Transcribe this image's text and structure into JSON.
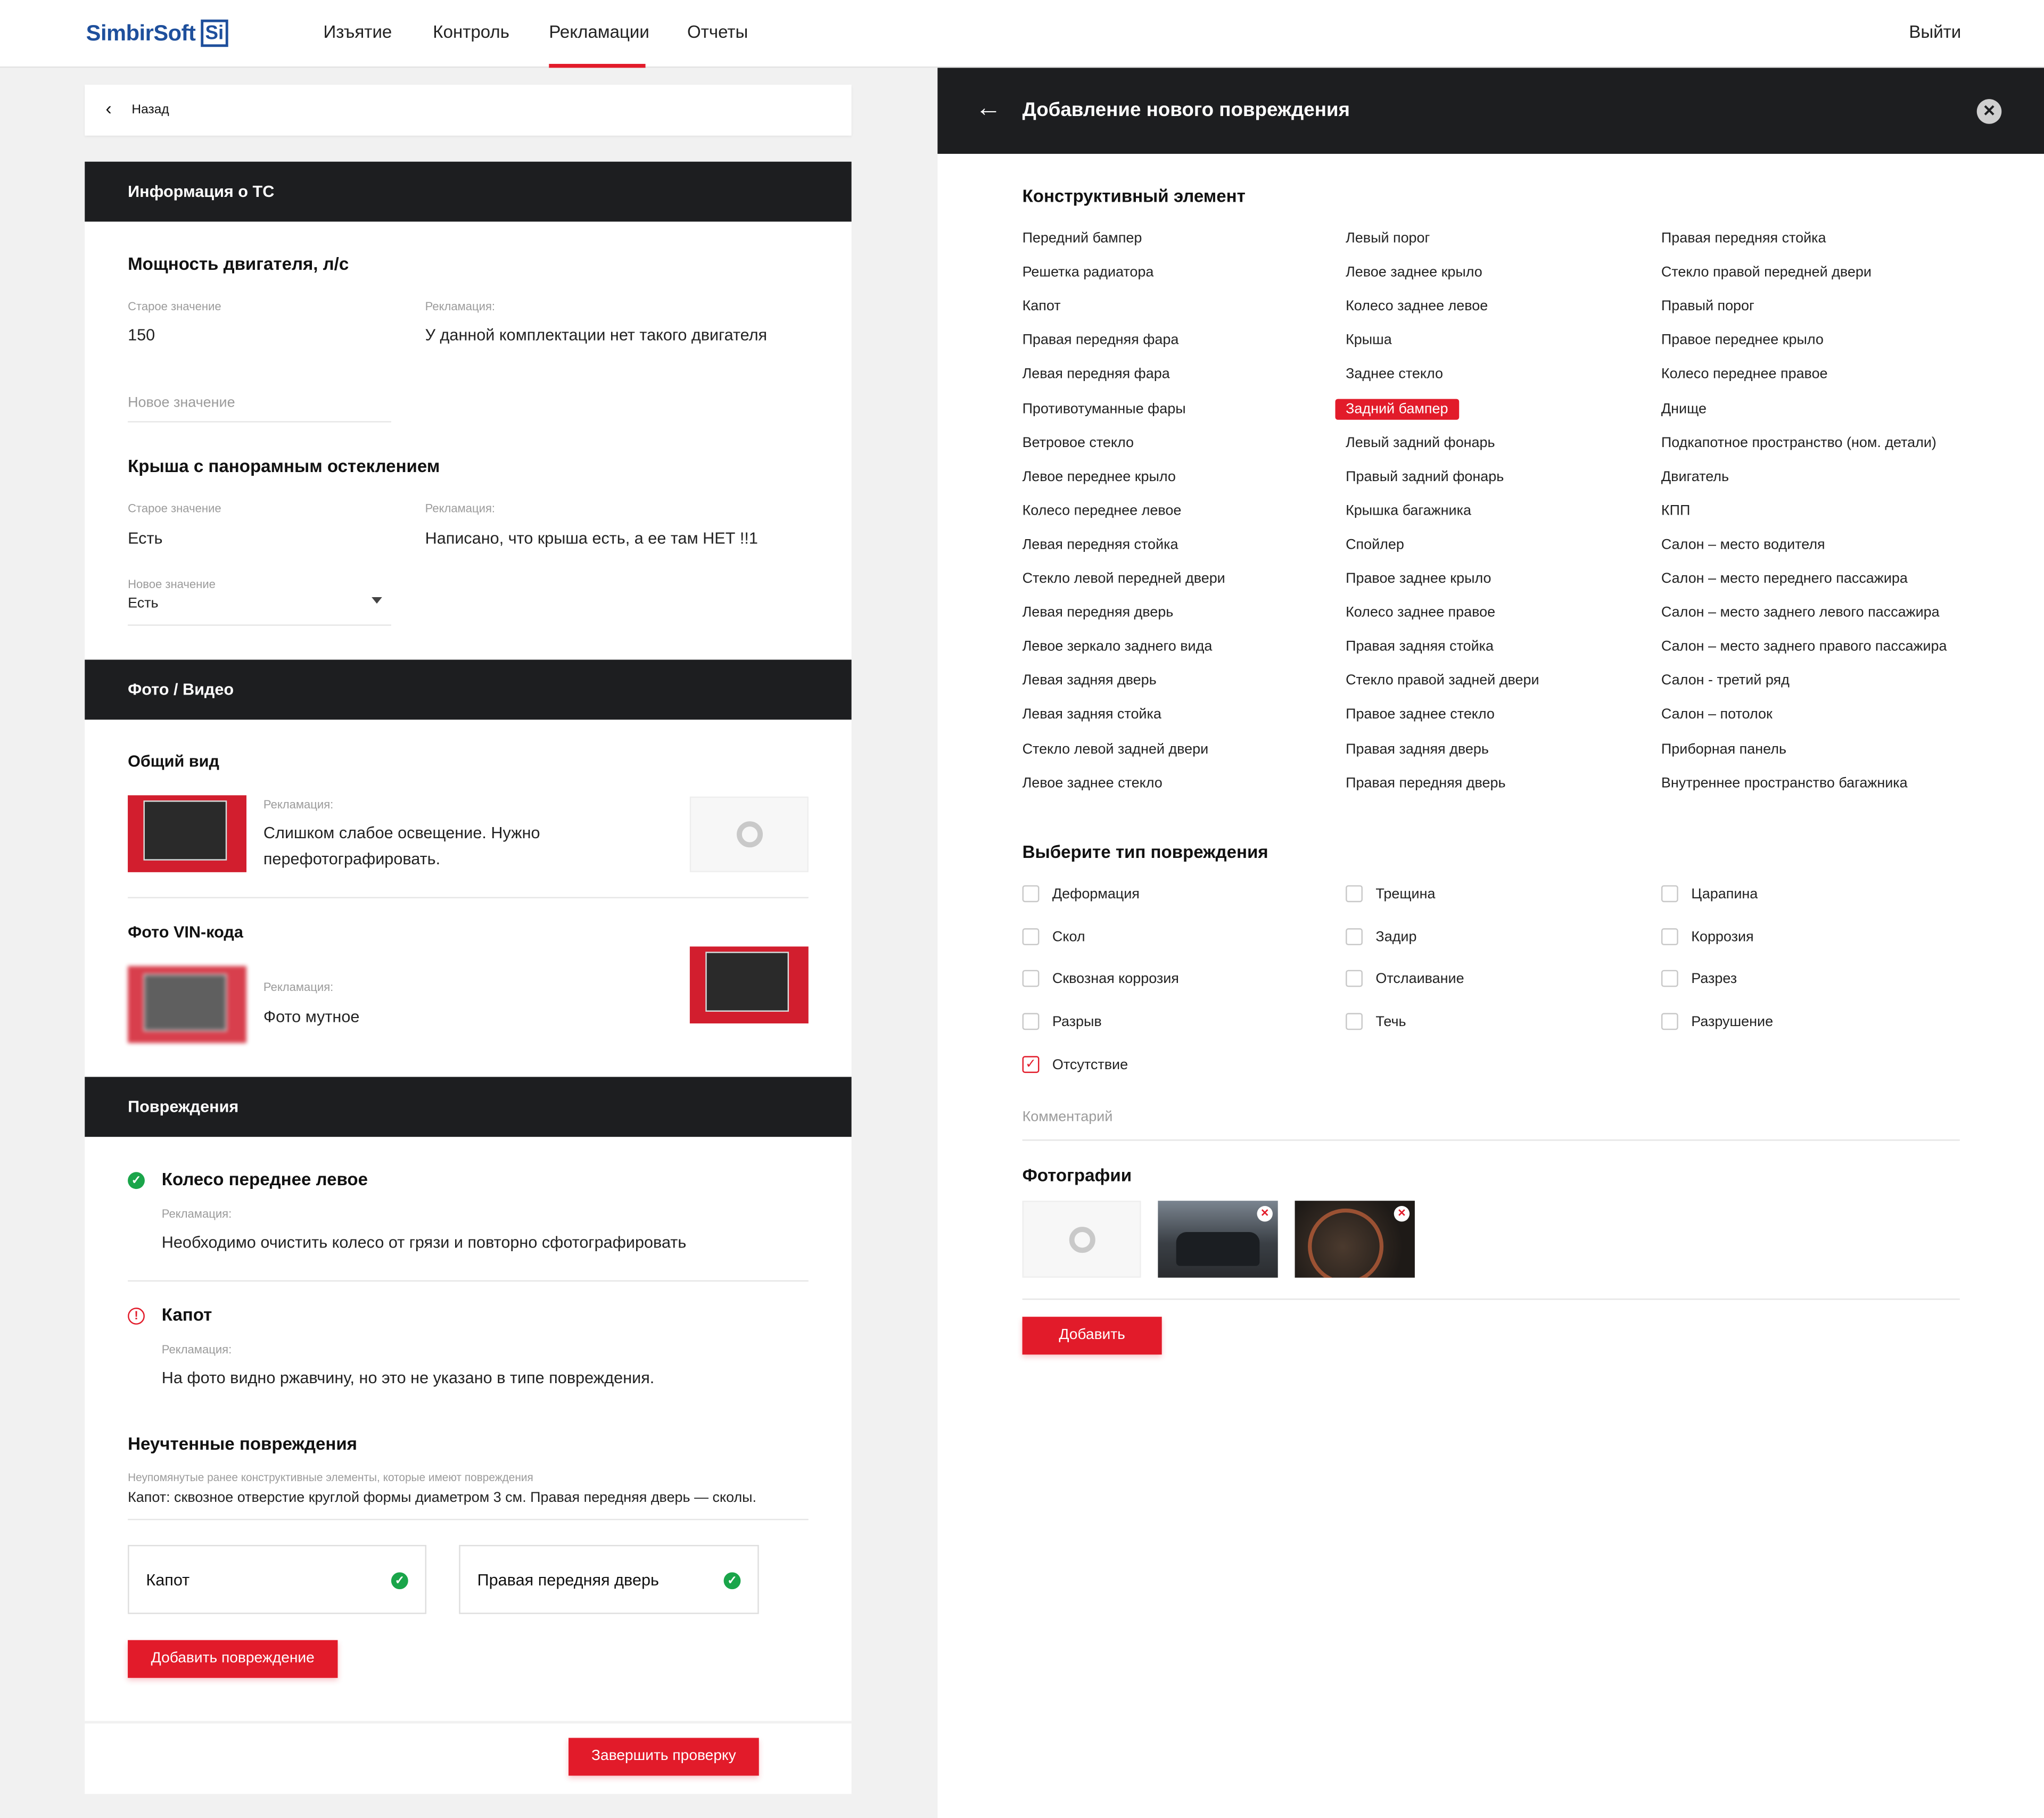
{
  "header": {
    "logo": "SimbirSoft",
    "logo_mark": "Si",
    "nav": [
      "Изъятие",
      "Контроль",
      "Рекламации",
      "Отчеты"
    ],
    "active_nav": "Рекламации",
    "exit": "Выйти"
  },
  "back": {
    "label": "Назад"
  },
  "vehicle": {
    "section_title": "Информация о ТС",
    "engine": {
      "title": "Мощность двигателя, л/с",
      "old_label": "Старое значение",
      "old_value": "150",
      "claim_label": "Рекламация:",
      "claim_value": "У данной комплектации нет такого двигателя",
      "new_placeholder": "Новое значение"
    },
    "roof": {
      "title": "Крыша с панорамным остеклением",
      "old_label": "Старое значение",
      "old_value": "Есть",
      "claim_label": "Рекламация:",
      "claim_value": "Написано, что крыша есть, а ее там НЕТ !!1",
      "new_label": "Новое значение",
      "new_value": "Есть"
    }
  },
  "media": {
    "section_title": "Фото / Видео",
    "general": {
      "title": "Общий вид",
      "claim_label": "Рекламация:",
      "claim_line1": "Слишком слабое освещение. Нужно",
      "claim_line2": "перефотографировать."
    },
    "vin": {
      "title": "Фото VIN-кода",
      "claim_label": "Рекламация:",
      "claim_value": "Фото мутное"
    }
  },
  "damages": {
    "section_title": "Повреждения",
    "items": [
      {
        "title": "Колесо переднее левое",
        "status": "ok",
        "claim_label": "Рекламация:",
        "claim": "Необходимо очистить колесо от грязи и повторно сфотографировать"
      },
      {
        "title": "Капот",
        "status": "warning",
        "claim_label": "Рекламация:",
        "claim": "На фото видно ржавчину, но это не указано в типе повреждения."
      }
    ],
    "unaccounted": {
      "title": "Неучтенные повреждения",
      "hint": "Неупомянутые ранее конструктивные элементы, которые имеют повреждения",
      "text": "Капот: сквозное отверстие круглой формы диаметром 3 см. Правая передняя дверь — сколы.",
      "boxes": [
        "Капот",
        "Правая передняя дверь"
      ]
    },
    "add_button": "Добавить повреждение",
    "finish_button": "Завершить проверку"
  },
  "panel": {
    "title": "Добавление нового повреждения",
    "elements_title": "Конструктивный элемент",
    "selected_element": "Задний бампер",
    "elements": [
      [
        "Передний бампер",
        "Решетка радиатора",
        "Капот",
        "Правая передняя фара",
        "Левая передняя фара",
        "Противотуманные фары",
        "Ветровое стекло",
        "Левое переднее крыло",
        "Колесо переднее левое",
        "Левая передняя стойка",
        "Стекло левой передней двери",
        "Левая передняя дверь",
        "Левое зеркало заднего вида",
        "Левая задняя дверь",
        "Левая задняя стойка",
        "Стекло левой задней двери",
        "Левое заднее стекло"
      ],
      [
        "Левый порог",
        "Левое заднее крыло",
        "Колесо заднее левое",
        "Крыша",
        "Заднее стекло",
        "Задний бампер",
        "Левый задний фонарь",
        "Правый задний фонарь",
        "Крышка багажника",
        "Спойлер",
        "Правое заднее крыло",
        "Колесо заднее правое",
        "Правая задняя стойка",
        "Стекло правой задней двери",
        "Правое заднее стекло",
        "Правая задняя дверь",
        "Правая передняя дверь"
      ],
      [
        "Правая передняя стойка",
        "Стекло правой передней двери",
        "Правый порог",
        "Правое переднее крыло",
        "Колесо переднее правое",
        "Днище",
        "Подкапотное пространство (ном. детали)",
        "Двигатель",
        "КПП",
        "Салон – место водителя",
        "Салон – место переднего пассажира",
        "Салон – место заднего левого пассажира",
        "Салон – место заднего правого пассажира",
        "Салон - третий ряд",
        "Салон – потолок",
        "Приборная панель",
        "Внутреннее пространство багажника"
      ]
    ],
    "damage_type_title": "Выберите тип повреждения",
    "damage_types": [
      {
        "label": "Деформация",
        "checked": false
      },
      {
        "label": "Трещина",
        "checked": false
      },
      {
        "label": "Царапина",
        "checked": false
      },
      {
        "label": "Скол",
        "checked": false
      },
      {
        "label": "Задир",
        "checked": false
      },
      {
        "label": "Коррозия",
        "checked": false
      },
      {
        "label": "Сквозная коррозия",
        "checked": false
      },
      {
        "label": "Отслаивание",
        "checked": false
      },
      {
        "label": "Разрез",
        "checked": false
      },
      {
        "label": "Разрыв",
        "checked": false
      },
      {
        "label": "Течь",
        "checked": false
      },
      {
        "label": "Разрушение",
        "checked": false
      },
      {
        "label": "Отсутствие",
        "checked": true
      }
    ],
    "comment_placeholder": "Комментарий",
    "photos_title": "Фотографии",
    "add_button": "Добавить",
    "colors": {
      "accent": "#e21b2a",
      "dark": "#1d1e20",
      "ok": "#1aa54a",
      "brand": "#1e4f9c"
    }
  }
}
